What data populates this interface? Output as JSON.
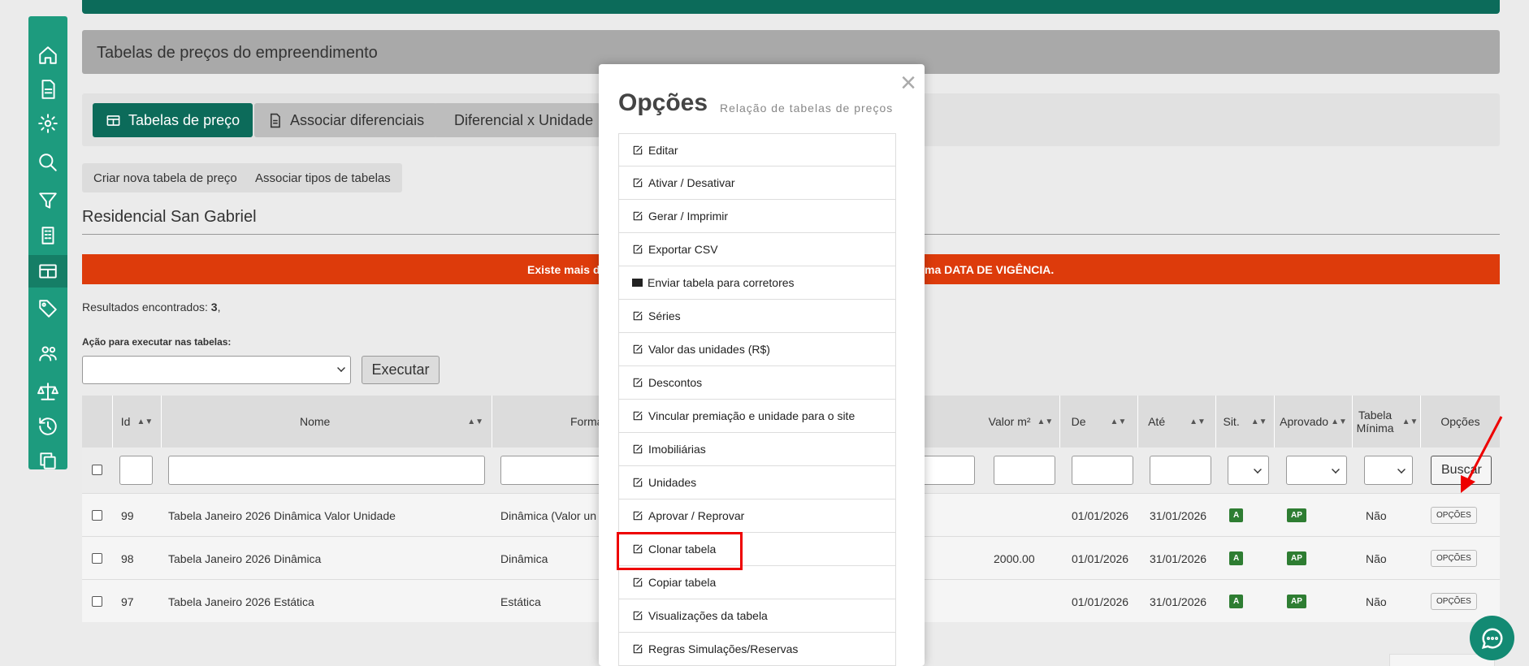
{
  "sidebar": {
    "items": [
      "home-icon",
      "document-icon",
      "settings-icon",
      "search-icon",
      "filter-icon",
      "building-icon",
      "table-icon",
      "tag-icon",
      "users-icon",
      "scale-icon",
      "history-icon",
      "copy-icon"
    ],
    "active": "table-icon"
  },
  "header": {
    "title": "Tabelas de preços do empreendimento"
  },
  "tabs": [
    {
      "label": "Tabelas de preço",
      "icon": "table-icon",
      "active": true
    },
    {
      "label": "Associar diferenciais",
      "icon": "document-icon"
    },
    {
      "label": "Diferencial x Unidade",
      "icon": "building-icon"
    }
  ],
  "actions": {
    "create_label": "Criar nova tabela de preço",
    "associate_label": "Associar tipos de tabelas"
  },
  "empreendimento": "Residencial San Gabriel",
  "alert": {
    "left_text": "Existe mais d",
    "right_text": "ma DATA DE VIGÊNCIA."
  },
  "results": {
    "label": "Resultados encontrados:",
    "count": "3",
    "suffix": ","
  },
  "action_form": {
    "label": "Ação para executar nas tabelas:",
    "execute_label": "Executar"
  },
  "table": {
    "headers": {
      "id": "Id",
      "nome": "Nome",
      "forma": "Forma",
      "valor_m2": "Valor m²",
      "de": "De",
      "ate": "Até",
      "sit": "Sit.",
      "aprovado": "Aprovado",
      "tabela_minima": "Tabela Mínima",
      "opcoes": "Opções"
    },
    "search_label": "Buscar",
    "rows": [
      {
        "id": "99",
        "nome": "Tabela Janeiro 2026 Dinâmica Valor Unidade",
        "forma": "Dinâmica (Valor un",
        "valor_m2": "",
        "de": "01/01/2026",
        "ate": "31/01/2026",
        "sit": "A",
        "aprovado": "AP",
        "minima": "Não",
        "opcoes": "OPÇÕES"
      },
      {
        "id": "98",
        "nome": "Tabela Janeiro 2026 Dinâmica",
        "forma": "Dinâmica",
        "valor_m2": "2000.00",
        "de": "01/01/2026",
        "ate": "31/01/2026",
        "sit": "A",
        "aprovado": "AP",
        "minima": "Não",
        "opcoes": "OPÇÕES"
      },
      {
        "id": "97",
        "nome": "Tabela Janeiro 2026 Estática",
        "forma": "Estática",
        "valor_m2": "",
        "de": "01/01/2026",
        "ate": "31/01/2026",
        "sit": "A",
        "aprovado": "AP",
        "minima": "Não",
        "opcoes": "OPÇÕES"
      }
    ]
  },
  "modal": {
    "title": "Opções",
    "subtitle": "Relação de tabelas de preços",
    "close": "×",
    "options": [
      "Editar",
      "Ativar / Desativar",
      "Gerar / Imprimir",
      "Exportar CSV",
      "Enviar tabela para corretores",
      "Séries",
      "Valor das unidades (R$)",
      "Descontos",
      "Vincular premiação e unidade para o site",
      "Imobiliárias",
      "Unidades",
      "Aprovar / Reprovar",
      "Clonar tabela",
      "Copiar tabela",
      "Visualizações da tabela",
      "Regras Simulações/Reservas"
    ],
    "highlighted": "Clonar tabela"
  },
  "colors": {
    "sidebar": "#1d9b7e",
    "primary": "#0c6b5a",
    "alert": "#dd3b0b",
    "badge": "#2e7d32",
    "highlight": "#ee0000"
  }
}
